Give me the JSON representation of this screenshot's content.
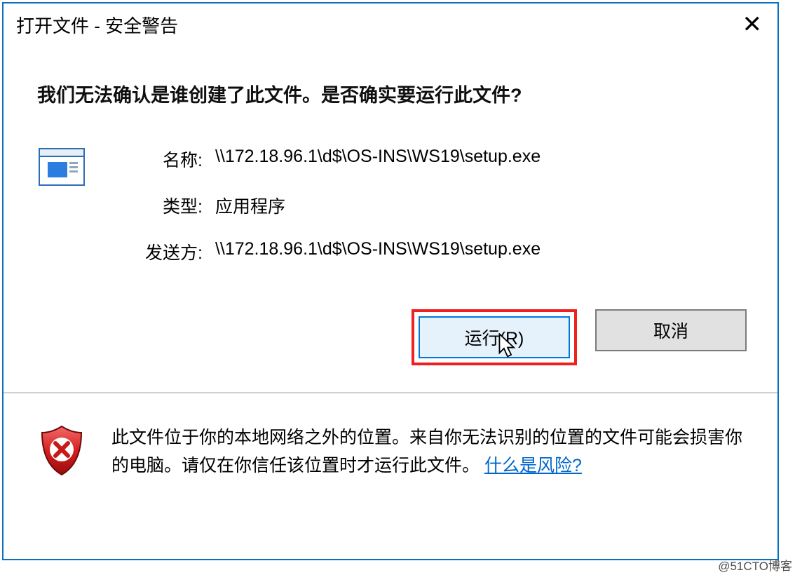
{
  "window": {
    "title": "打开文件 - 安全警告"
  },
  "headline": "我们无法确认是谁创建了此文件。是否确实要运行此文件?",
  "fields": {
    "name_label": "名称:",
    "name_value": "\\\\172.18.96.1\\d$\\OS-INS\\WS19\\setup.exe",
    "type_label": "类型:",
    "type_value": "应用程序",
    "from_label": "发送方:",
    "from_value": "\\\\172.18.96.1\\d$\\OS-INS\\WS19\\setup.exe"
  },
  "buttons": {
    "run": "运行(R)",
    "cancel": "取消"
  },
  "footer": {
    "text_part1": "此文件位于你的本地网络之外的位置。来自你无法识别的位置的文件可能会损害你的电脑。请仅在你信任该位置时才运行此文件。",
    "risk_link": "什么是风险?"
  },
  "watermark": "@51CTO博客"
}
